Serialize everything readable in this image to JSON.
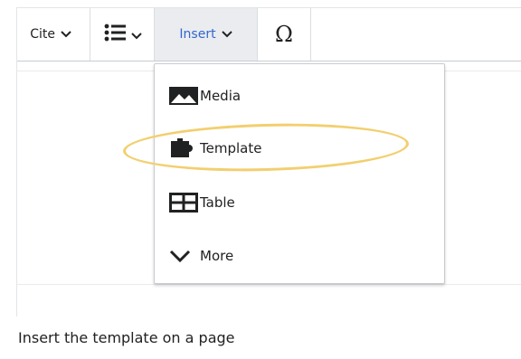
{
  "toolbar": {
    "cite_label": "Cite",
    "insert_label": "Insert",
    "special_char_label": "Ω",
    "list_icon": "bullet-list-icon",
    "accent": "#3366cc"
  },
  "insert_menu": {
    "items": [
      {
        "label": "Media",
        "icon": "image-icon"
      },
      {
        "label": "Template",
        "icon": "puzzle-icon"
      },
      {
        "label": "Table",
        "icon": "table-icon"
      },
      {
        "label": "More",
        "icon": "chevron-down-icon"
      }
    ],
    "highlight_color": "#f2cf6f"
  },
  "caption": "Insert the template on a page"
}
